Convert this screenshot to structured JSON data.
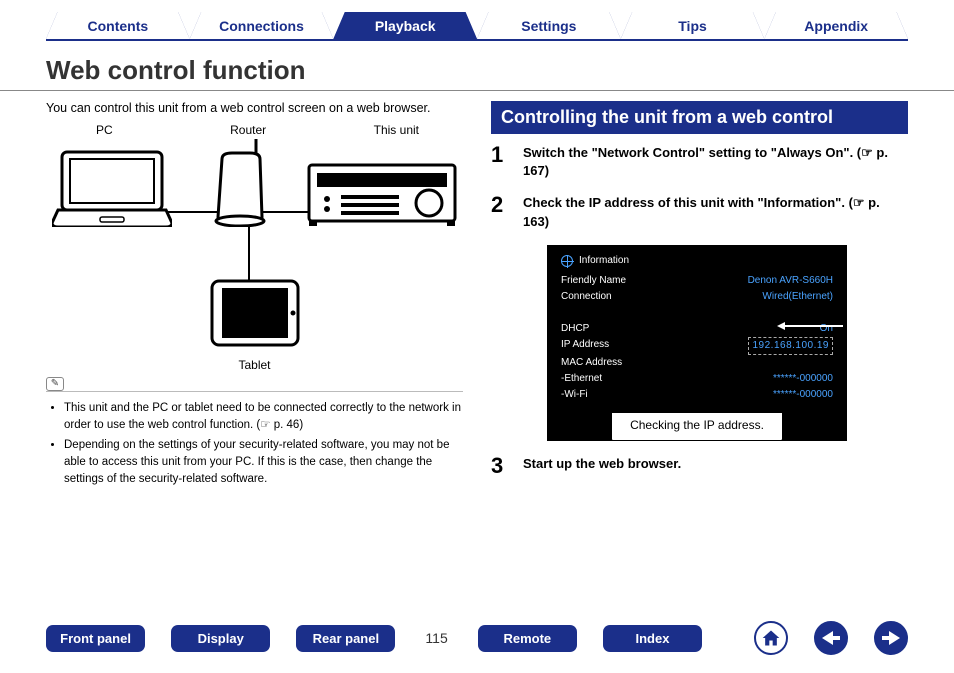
{
  "tabs": {
    "items": [
      {
        "label": "Contents",
        "active": false
      },
      {
        "label": "Connections",
        "active": false
      },
      {
        "label": "Playback",
        "active": true
      },
      {
        "label": "Settings",
        "active": false
      },
      {
        "label": "Tips",
        "active": false
      },
      {
        "label": "Appendix",
        "active": false
      }
    ]
  },
  "page": {
    "title": "Web control function",
    "intro": "You can control this unit from a web control screen on a web browser.",
    "number": "115"
  },
  "diagram": {
    "labels": {
      "pc": "PC",
      "router": "Router",
      "unit": "This unit",
      "tablet": "Tablet"
    }
  },
  "notes": {
    "items": [
      "This unit and the PC or tablet need to be connected correctly to the network in order to use the web control function. (☞ p. 46)",
      "Depending on the settings of your security-related software, you may not be able to access this unit from your PC. If this is the case, then change the settings of the security-related software."
    ]
  },
  "section": {
    "heading": "Controlling the unit from a web control"
  },
  "steps": [
    {
      "num": "1",
      "text": "Switch the \"Network Control\" setting to \"Always On\". (☞ p. 167)"
    },
    {
      "num": "2",
      "text": "Check the IP address of this unit with \"Information\". (☞ p. 163)"
    },
    {
      "num": "3",
      "text": "Start up the web browser."
    }
  ],
  "info_panel": {
    "header": "Information",
    "rows": [
      {
        "k": "Friendly Name",
        "v": "Denon AVR-S660H"
      },
      {
        "k": "Connection",
        "v": "Wired(Ethernet)"
      },
      {
        "k": "",
        "v": ""
      },
      {
        "k": "DHCP",
        "v": "On"
      },
      {
        "k": "IP Address",
        "v": "192.168.100.19",
        "boxed": true
      },
      {
        "k": "MAC Address",
        "v": ""
      },
      {
        "k": " -Ethernet",
        "v": "******-000000"
      },
      {
        "k": " -Wi-Fi",
        "v": "******-000000"
      }
    ],
    "caption": "Checking the IP address."
  },
  "footer": {
    "buttons": [
      {
        "label": "Front panel"
      },
      {
        "label": "Display"
      },
      {
        "label": "Rear panel"
      },
      {
        "label": "Remote"
      },
      {
        "label": "Index"
      }
    ]
  }
}
